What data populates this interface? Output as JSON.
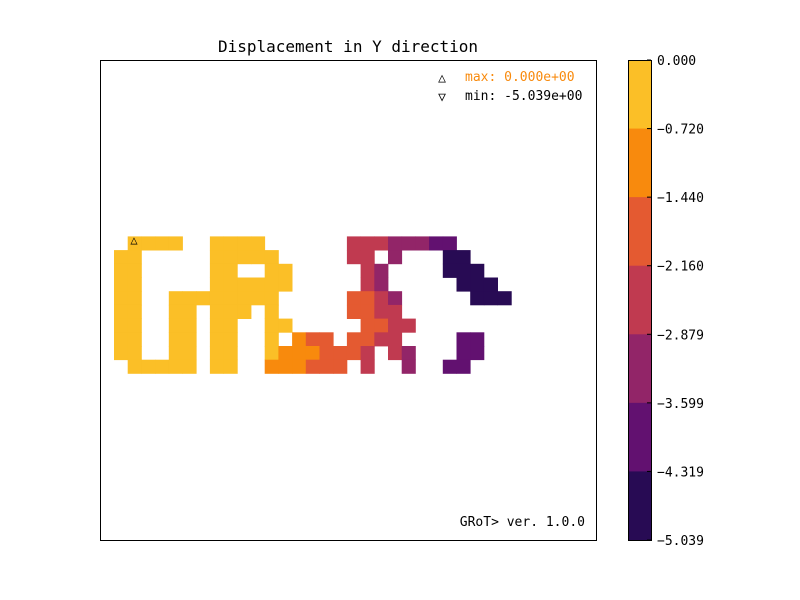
{
  "chart_data": {
    "type": "heatmap",
    "title": "Displacement in Y direction",
    "annotations": {
      "max_label": "max:  0.000e+00",
      "min_label": "min: -5.039e+00",
      "max_marker": "△",
      "min_marker": "▽",
      "version": "GRoT> ver. 1.0.0"
    },
    "colorbar": {
      "ticks": [
        "0.000",
        "−0.720",
        "−1.440",
        "−2.160",
        "−2.879",
        "−3.599",
        "−4.319",
        "−5.039"
      ],
      "colors": [
        "#fbbf27",
        "#f88a0d",
        "#e45a31",
        "#c03a50",
        "#922568",
        "#621170",
        "#280b54"
      ]
    },
    "grid_rows": [
      "..........................",
      "..........................",
      "..........................",
      "..........................",
      "..........................",
      "..........................",
      "..........................",
      "..........................",
      "..........................",
      "..........................",
      "..........................",
      "..........................",
      ".0000..0000......33344455.",
      "00.....00000.....33.4...66",
      "00.....00..00.....34....666",
      "00.....000000.....34.....666",
      "00..00000000.....2234.....666",
      "00..00.000.0.....2233.......",
      "00..00.00..00.....2233.....",
      "00..00.00..0.122.2233....55",
      "00..00.00..01112223.34...55",
      ".00000.00..111222.3..4..55.",
      "..........................",
      "..........................",
      "..........................",
      "..........................",
      "..........................",
      "..........................",
      "..........................",
      "..........................",
      "..........................",
      "..........................",
      "..........................",
      "..........................",
      ".........................."
    ]
  }
}
